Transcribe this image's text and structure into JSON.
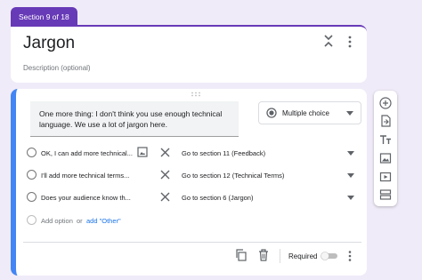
{
  "section": {
    "badge": "Section 9 of 18",
    "title": "Jargon",
    "description_placeholder": "Description (optional)"
  },
  "question": {
    "text": "One more thing: I don't think you use enough technical language. We use a lot of jargon here.",
    "type": "Multiple choice",
    "options": [
      {
        "label": "OK, I can add more technical...",
        "goto": "Go to section 11 (Feedback)"
      },
      {
        "label": "I'll add more technical terms...",
        "goto": "Go to section 12 (Technical Terms)"
      },
      {
        "label": "Does your audience know th...",
        "goto": "Go to section 6 (Jargon)"
      }
    ],
    "add_option": "Add option",
    "or": "or",
    "add_other": "add \"Other\"",
    "required_label": "Required",
    "required": false
  },
  "colors": {
    "accent": "#673ab7",
    "active_border": "#4285f4",
    "link": "#1a73e8",
    "background": "#f0ebf8"
  },
  "toolbar": {
    "icons": [
      "add-question-icon",
      "import-questions-icon",
      "add-title-icon",
      "add-image-icon",
      "add-video-icon",
      "add-section-icon"
    ]
  }
}
